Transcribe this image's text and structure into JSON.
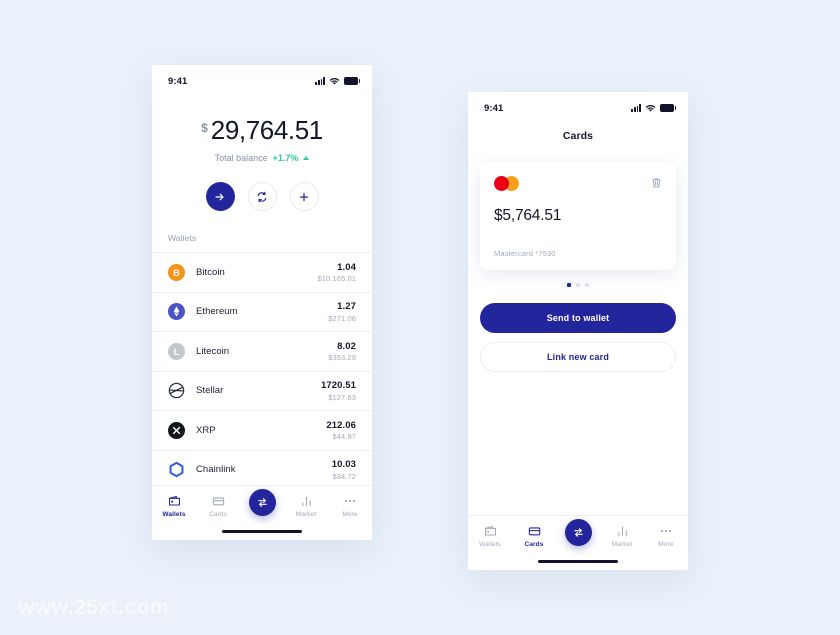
{
  "background_color": "#eaf1fa",
  "accent_color": "#23259c",
  "positive_color": "#2bc8a4",
  "watermark": "www.25xt.com",
  "phone_wallets": {
    "status_bar": {
      "time": "9:41",
      "icons": [
        "signal-bars-icon",
        "wifi-icon",
        "battery-icon"
      ]
    },
    "balance": {
      "currency_symbol": "$",
      "amount": "29,764.51",
      "label": "Total balance",
      "change": "+1.7%",
      "change_direction": "up"
    },
    "actions": [
      {
        "name": "send-button",
        "icon": "arrow-right-icon",
        "style": "primary"
      },
      {
        "name": "exchange-button",
        "icon": "refresh-icon",
        "style": "ghost"
      },
      {
        "name": "add-button",
        "icon": "plus-icon",
        "style": "ghost"
      }
    ],
    "section_label": "Wallets",
    "wallets": [
      {
        "name": "Bitcoin",
        "icon": "bitcoin-icon",
        "amount": "1.04",
        "usd": "$10,165.01"
      },
      {
        "name": "Ethereum",
        "icon": "ethereum-icon",
        "amount": "1.27",
        "usd": "$271.06"
      },
      {
        "name": "Litecoin",
        "icon": "litecoin-icon",
        "amount": "8.02",
        "usd": "$353.29"
      },
      {
        "name": "Stellar",
        "icon": "stellar-icon",
        "amount": "1720.51",
        "usd": "$127.63"
      },
      {
        "name": "XRP",
        "icon": "xrp-icon",
        "amount": "212.06",
        "usd": "$44.97"
      },
      {
        "name": "Chainlink",
        "icon": "chainlink-icon",
        "amount": "10.03",
        "usd": "$34.72"
      }
    ],
    "tabs": [
      {
        "label": "Wallets",
        "icon": "wallet-icon",
        "active": true
      },
      {
        "label": "Cards",
        "icon": "card-icon",
        "active": false
      },
      {
        "label": "",
        "icon": "exchange-icon",
        "fab": true
      },
      {
        "label": "Market",
        "icon": "chart-bars-icon",
        "active": false
      },
      {
        "label": "More",
        "icon": "ellipsis-icon",
        "active": false
      }
    ]
  },
  "phone_cards": {
    "status_bar": {
      "time": "9:41",
      "icons": [
        "signal-bars-icon",
        "wifi-icon",
        "battery-icon"
      ]
    },
    "title": "Cards",
    "card": {
      "brand_icon": "mastercard-icon",
      "delete_icon": "trash-icon",
      "amount": "$5,764.51",
      "meta": "Mastercard *7530"
    },
    "pagination": {
      "count": 3,
      "active_index": 0
    },
    "buttons": {
      "primary": "Send to wallet",
      "secondary": "Link new card"
    },
    "tabs": [
      {
        "label": "Wallets",
        "icon": "wallet-icon",
        "active": false
      },
      {
        "label": "Cards",
        "icon": "card-icon",
        "active": true
      },
      {
        "label": "",
        "icon": "exchange-icon",
        "fab": true
      },
      {
        "label": "Market",
        "icon": "chart-bars-icon",
        "active": false
      },
      {
        "label": "More",
        "icon": "ellipsis-icon",
        "active": false
      }
    ]
  }
}
